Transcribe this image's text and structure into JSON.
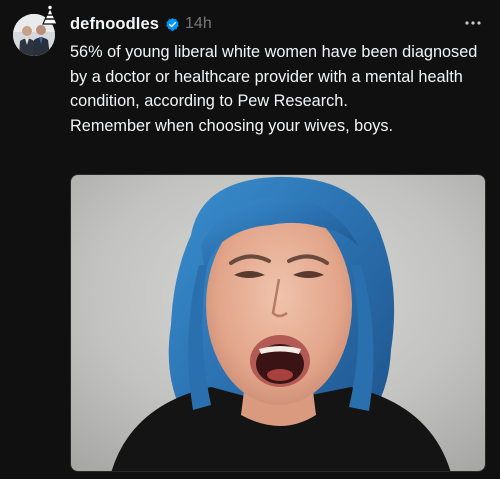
{
  "post": {
    "username": "defnoodles",
    "verified": true,
    "timestamp": "14h",
    "text_lines": [
      "56% of young liberal white women have been diagnosed by a doctor or healthcare provider with a mental health condition, according to Pew Research.",
      "Remember when choosing your wives, boys."
    ]
  },
  "icons": {
    "avatar_badge": "party-hat-icon",
    "verified": "verified-badge-icon",
    "more": "more-options-icon"
  },
  "colors": {
    "background": "#101010",
    "text": "#f3f5f7",
    "muted": "#777777",
    "verified": "#0095f6"
  }
}
